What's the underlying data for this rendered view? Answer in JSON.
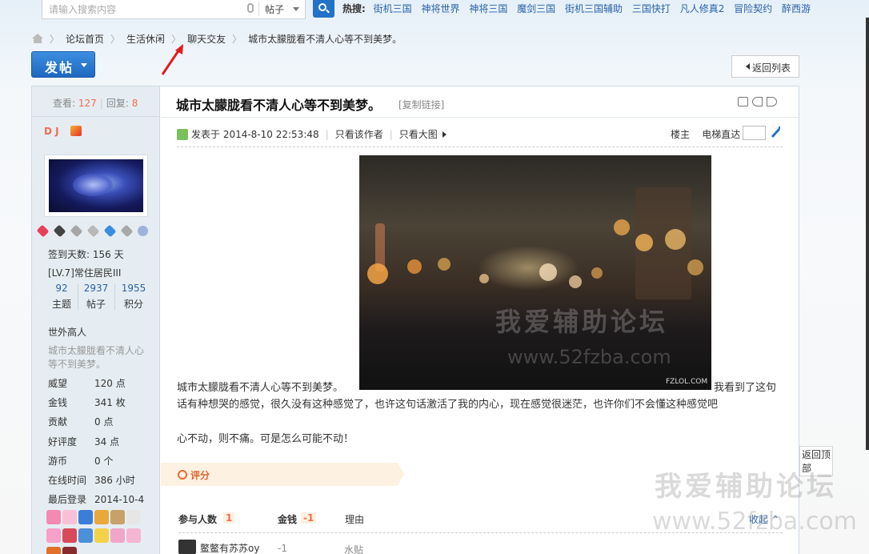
{
  "search": {
    "placeholder": "请输入搜索内容",
    "type": "帖子",
    "hot_label": "热搜:",
    "hot_links": [
      "街机三国",
      "神将世界",
      "神将三国",
      "魔剑三国",
      "街机三国辅助",
      "三国快打",
      "凡人修真2",
      "冒险契约",
      "醉西游"
    ]
  },
  "breadcrumb": [
    "论坛首页",
    "生活休闲",
    "聊天交友",
    "城市太朦胧看不清人心等不到美梦。"
  ],
  "toolbar": {
    "post_label": "发帖",
    "back_label": "返回列表"
  },
  "thread": {
    "views_label": "查看:",
    "views": "127",
    "replies_label": "回复:",
    "replies": "8",
    "title": "城市太朦胧看不清人心等不到美梦。",
    "copy_link": "[复制链接]"
  },
  "author": {
    "name": "D J",
    "checkin": "签到天数: 156 天",
    "level": "[LV.7]常住居民III",
    "stats": [
      {
        "value": "92",
        "label": "主题"
      },
      {
        "value": "2937",
        "label": "帖子"
      },
      {
        "value": "1955",
        "label": "积分"
      }
    ],
    "group": "世外高人",
    "signature": "城市太朦胧看不清人心等不到美梦。",
    "profile": [
      {
        "k": "威望",
        "v": "120 点"
      },
      {
        "k": "金钱",
        "v": "341 枚"
      },
      {
        "k": "贡献",
        "v": "0 点"
      },
      {
        "k": "好评度",
        "v": "34 点"
      },
      {
        "k": "游币",
        "v": "0 个"
      },
      {
        "k": "在线时间",
        "v": "386 小时"
      },
      {
        "k": "最后登录",
        "v": "2014-10-4"
      }
    ]
  },
  "post": {
    "posted": "发表于 2014-8-10 22:53:48",
    "only_author": "只看该作者",
    "big_image": "只看大图",
    "floor": "楼主",
    "jump": "电梯直达",
    "image_watermark": "我爱辅助论坛",
    "image_watermark_url": "www.52fzba.com",
    "image_tag": "FZLOL.COM",
    "line1a": "城市太朦胧看不清人心等不到美梦。",
    "line1b": "我看到了这句",
    "line2": "话有种想哭的感觉，很久没有这种感觉了，也许这句话激活了我的内心，现在感觉很迷茫，也许你们不会懂这种感觉吧",
    "line3": "心不动，则不痛。可是怎么可能不动！"
  },
  "rating": {
    "title": "评分",
    "participants_label": "参与人数",
    "participants": "1",
    "money_label": "金钱",
    "money": "-1",
    "reason_label": "理由",
    "collapse": "收起",
    "rows": [
      {
        "user": "鳖鳖有苏苏oy",
        "money": "-1",
        "reason": "水贴"
      }
    ]
  },
  "float": {
    "totop": "返回顶部"
  },
  "site_watermark": {
    "name": "我爱辅助论坛",
    "url": "www.52fzba.com"
  },
  "colors": {
    "accent": "#2272c8",
    "highlight": "#f26c4f",
    "link": "#2a61a8",
    "rate_bg": "#fdf1e1"
  }
}
